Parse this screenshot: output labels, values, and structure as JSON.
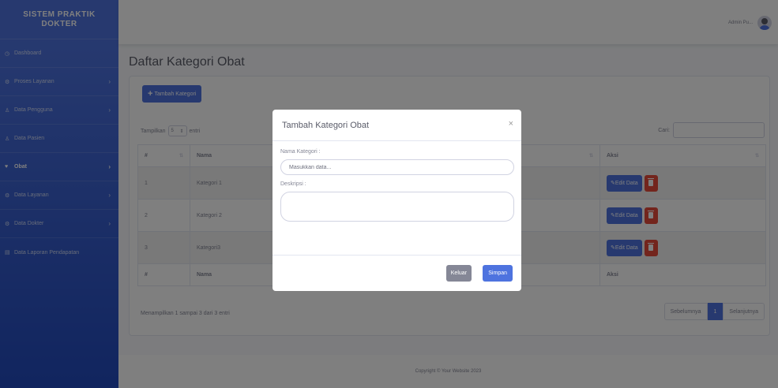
{
  "colors": {
    "primary": "#4e73df",
    "danger": "#e74a3b",
    "secondary": "#858796"
  },
  "sidebar": {
    "brand_line1": "SISTEM PRAKTIK",
    "brand_line2": "DOKTER",
    "items": [
      {
        "label": "Dashboard",
        "icon": "dashboard-icon"
      },
      {
        "label": "Proses Layanan",
        "icon": "gear-icon"
      },
      {
        "label": "Data Pengguna",
        "icon": "user-icon"
      },
      {
        "label": "Data Pasien",
        "icon": "user-icon"
      },
      {
        "label": "Obat",
        "icon": "heart-icon"
      },
      {
        "label": "Data Layanan",
        "icon": "gear-icon"
      },
      {
        "label": "Data Dokter",
        "icon": "gear-icon"
      },
      {
        "label": "Data Laporan Pendapatan",
        "icon": "report-icon"
      }
    ]
  },
  "topbar": {
    "user_name": "Admin Pu..."
  },
  "main": {
    "title": "Daftar Kategori Obat",
    "add_button": "Tambah Kategori",
    "show_label_prefix": "Tampilkan",
    "show_value": "5",
    "show_label_suffix": "entri",
    "search_label": "Cari:",
    "table": {
      "headers": [
        "#",
        "Nama",
        "Aksi"
      ],
      "rows": [
        {
          "no": "1",
          "name": "Kategori 1"
        },
        {
          "no": "2",
          "name": "Kategori 2"
        },
        {
          "no": "3",
          "name": "Kategori3"
        }
      ],
      "edit_label": "Edit Data"
    },
    "info": "Menampilkan 1 sampai 3 dari 3 entri",
    "pagination": {
      "prev": "Sebelumnya",
      "current": "1",
      "next": "Selanjutnya"
    }
  },
  "footer": {
    "text": "Copyright © Your Website 2023"
  },
  "modal": {
    "title": "Tambah Kategori Obat",
    "close": "×",
    "name_label": "Nama Kategori :",
    "name_placeholder": "Masukkan data...",
    "desc_label": "Deskripsi :",
    "cancel": "Keluar",
    "save": "Simpan"
  }
}
